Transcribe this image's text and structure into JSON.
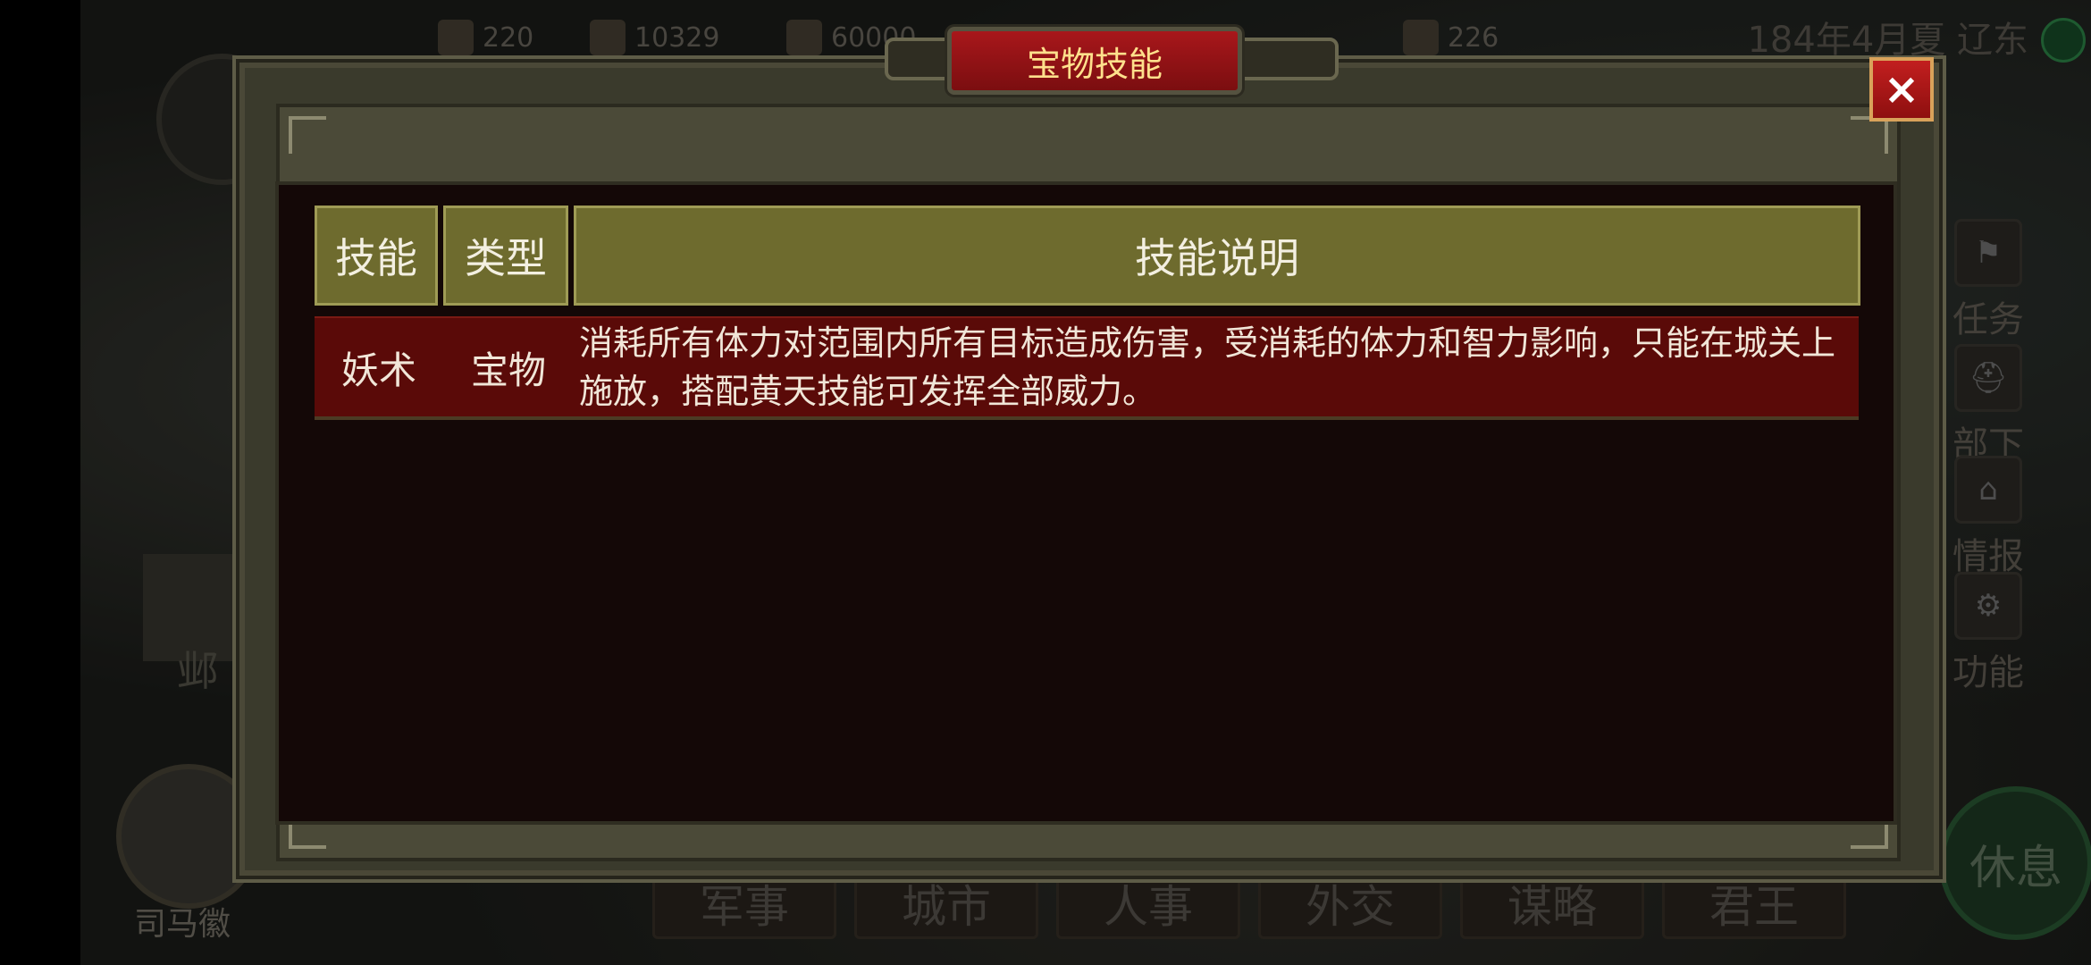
{
  "resources": [
    {
      "icon": "grain-icon",
      "value": "220"
    },
    {
      "icon": "gold-icon",
      "value": "10329"
    },
    {
      "icon": "troops-icon",
      "value": "60000"
    },
    {
      "icon": "supply-icon",
      "value": "226"
    }
  ],
  "status": {
    "date": "184年4月夏",
    "region": "辽东"
  },
  "left": {
    "city_name": "邺",
    "advisor_name": "司马徽"
  },
  "side_menu": [
    {
      "label": "任务",
      "icon": "flag-icon"
    },
    {
      "label": "部下",
      "icon": "helmet-icon"
    },
    {
      "label": "情报",
      "icon": "building-icon"
    },
    {
      "label": "功能",
      "icon": "gear-icon"
    }
  ],
  "rest_button": "休息",
  "bottom_tabs": [
    "军事",
    "城市",
    "人事",
    "外交",
    "谋略",
    "君王"
  ],
  "dialog": {
    "title": "宝物技能",
    "close_icon": "×",
    "table": {
      "headers": [
        "技能",
        "类型",
        "技能说明"
      ],
      "rows": [
        {
          "skill": "妖术",
          "type": "宝物",
          "description": "消耗所有体力对范围内所有目标造成伤害，受消耗的体力和智力影响，只能在城关上施放，搭配黄天技能可发挥全部威力。"
        }
      ]
    }
  },
  "colors": {
    "title_bg": "#a8171b",
    "title_text": "#ffe08c",
    "header_bg": "#6e6b2e",
    "row_bg": "#5a0a08",
    "content_bg": "#140807"
  }
}
